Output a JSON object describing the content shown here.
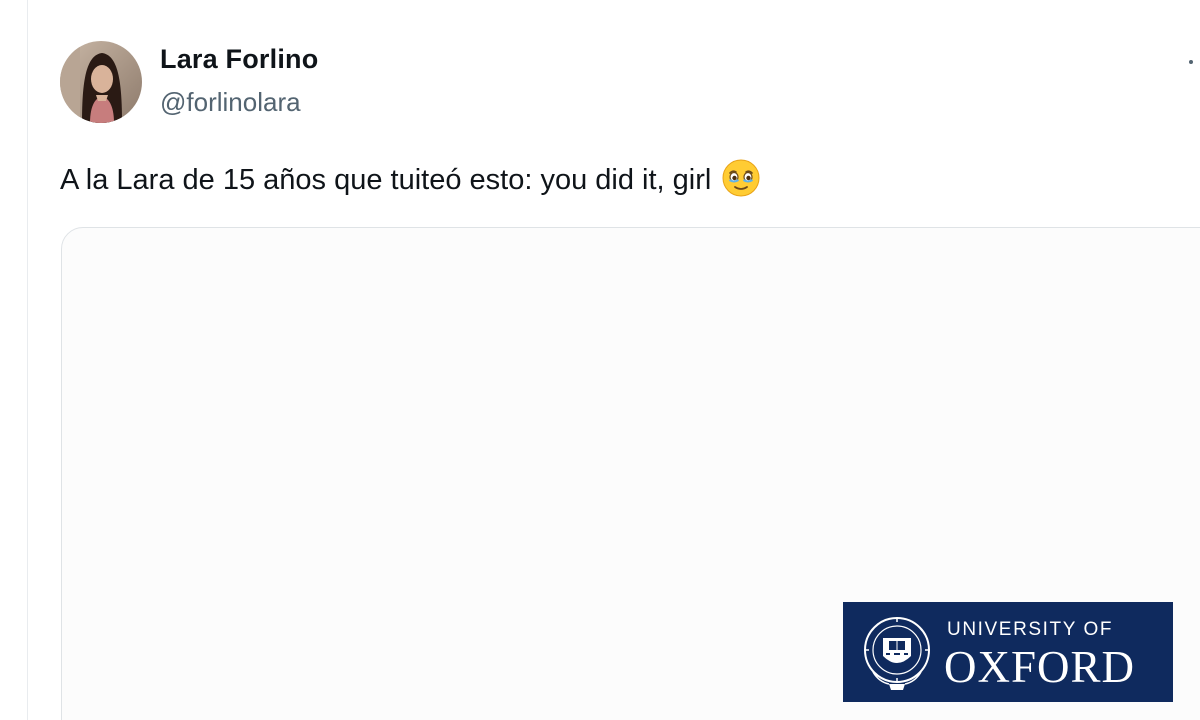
{
  "tweet": {
    "author": {
      "display_name": "Lara Forlino",
      "handle": "@forlinolara",
      "avatar_icon": "profile-photo"
    },
    "text": "A la Lara de 15 años que tuiteó esto: you did it, girl",
    "emoji_icon": "face-holding-back-tears-emoji",
    "more_icon": "more-options-icon"
  },
  "media": {
    "logo": {
      "line1": "UNIVERSITY OF",
      "line2": "OXFORD",
      "crest_icon": "oxford-crest-icon"
    }
  },
  "colors": {
    "text_primary": "#0f1419",
    "text_secondary": "#536471",
    "oxford_blue": "#0f2a5e",
    "card_border": "#dfe3e6"
  }
}
